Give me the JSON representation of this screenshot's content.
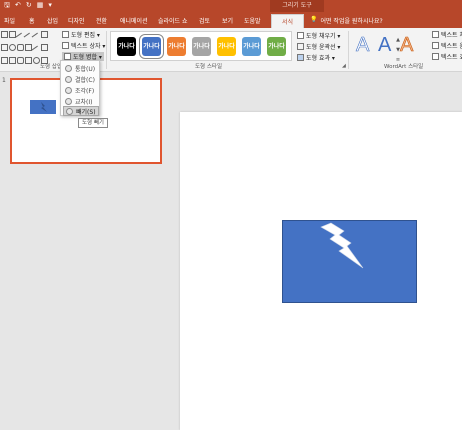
{
  "qat": {
    "save": "🖫",
    "undo": "↶",
    "redo": "↻",
    "present": "▦",
    "more": "▾"
  },
  "context_title": "그리기 도구",
  "tabs": [
    "파일",
    "홈",
    "삽입",
    "디자인",
    "전환",
    "애니메이션",
    "슬라이드 쇼",
    "검토",
    "보기",
    "도움말",
    "서식"
  ],
  "tell_me": {
    "icon": "lightbulb-icon",
    "text": "어떤 작업을 원하시나요?"
  },
  "ribbon": {
    "insert_shapes": {
      "label": "도형 삽입",
      "edit_shape": "도형 편집 ▾",
      "text_box": "텍스트 상자 ▾",
      "merge_shapes": "도형 병합 ▾"
    },
    "shape_styles": {
      "label": "도형 스타일",
      "tile_text": "가나다",
      "tile_colors": [
        "#000000",
        "#4472c4",
        "#ed7d31",
        "#a5a5a5",
        "#ffc000",
        "#5b9bd5",
        "#70ad47"
      ],
      "fill": "도형 채우기 ▾",
      "outline": "도형 윤곽선 ▾",
      "effects": "도형 효과 ▾"
    },
    "wordart": {
      "label": "WordArt 스타일",
      "letter": "A",
      "text_fill": "텍스트 채",
      "text_outline": "텍스트 윤",
      "text_effects": "텍스트 효"
    }
  },
  "merge_menu": {
    "items": [
      "통합(U)",
      "결합(C)",
      "조각(F)",
      "교차(I)",
      "빼기(S)"
    ],
    "highlighted_index": 4,
    "tooltip": "도형 빼기"
  },
  "thumbnails": {
    "slide_number": "1"
  },
  "colors": {
    "accent": "#b7472a",
    "shape_fill": "#4472c4",
    "thumb_border": "#e0552f"
  }
}
